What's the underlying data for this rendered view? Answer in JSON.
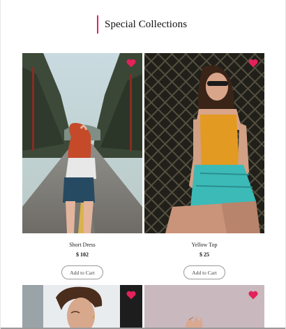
{
  "header": {
    "title": "Special Collections",
    "accent_color": "#e3215a"
  },
  "products": [
    {
      "name": "Short Dress",
      "price": "$ 102",
      "cart_label": "Add to Cart",
      "icon": "heart-icon"
    },
    {
      "name": "Yellow Top",
      "price": "$ 25",
      "cart_label": "Add to Cart",
      "icon": "heart-icon"
    }
  ],
  "next_row": [
    {
      "icon": "heart-icon"
    },
    {
      "icon": "heart-icon"
    }
  ],
  "colors": {
    "heart": "#e3215a",
    "button_border": "#999999"
  }
}
